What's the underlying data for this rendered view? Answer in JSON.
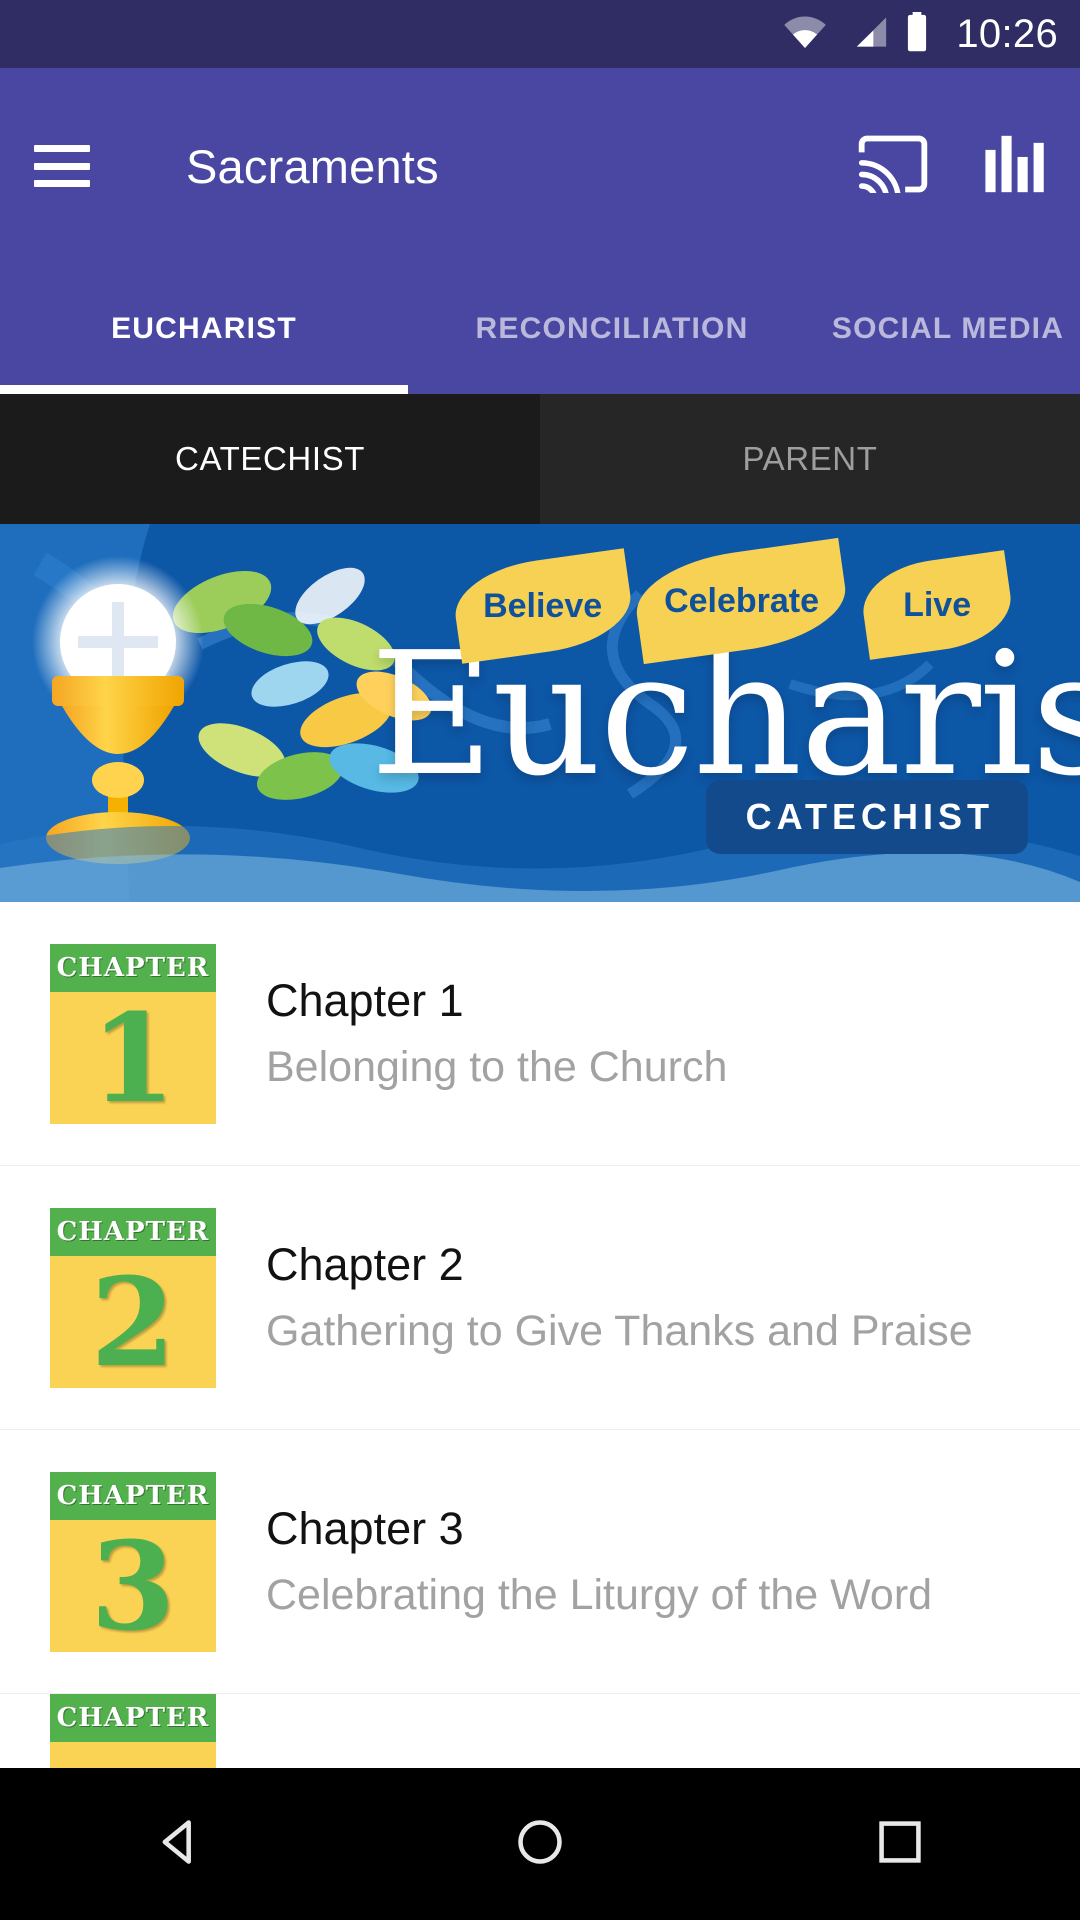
{
  "status_bar": {
    "time": "10:26",
    "icons": [
      "wifi-icon",
      "cellular-signal-icon",
      "battery-icon"
    ],
    "background_color": "#2f2d63"
  },
  "app_bar": {
    "menu_icon": "hamburger-menu-icon",
    "title": "Sacraments",
    "actions": [
      "cast-icon",
      "bar-chart-icon"
    ],
    "background_color": "#4a47a3"
  },
  "primary_tabs": {
    "items": [
      {
        "label": "EUCHARIST",
        "active": true
      },
      {
        "label": "RECONCILIATION",
        "active": false
      },
      {
        "label": "SOCIAL MEDIA",
        "active": false
      }
    ],
    "indicator_color": "#ffffff"
  },
  "sub_tabs": {
    "items": [
      {
        "label": "CATECHIST",
        "active": true
      },
      {
        "label": "PARENT",
        "active": false
      }
    ],
    "active_background": "#1b1b1b",
    "inactive_background": "#262626"
  },
  "banner": {
    "title": "Eucharist",
    "leaves": [
      "Believe",
      "Celebrate",
      "Live"
    ],
    "badge": "CATECHIST",
    "background_color": "#0d57a7",
    "leaf_color": "#f6d154",
    "leaf_text_color": "#10519b"
  },
  "chapters": [
    {
      "thumb_label": "CHAPTER",
      "number": "1",
      "title": "Chapter 1",
      "subtitle": "Belonging to the Church"
    },
    {
      "thumb_label": "CHAPTER",
      "number": "2",
      "title": "Chapter 2",
      "subtitle": "Gathering to Give Thanks and Praise"
    },
    {
      "thumb_label": "CHAPTER",
      "number": "3",
      "title": "Chapter 3",
      "subtitle": "Celebrating the Liturgy of the Word"
    }
  ],
  "chapter_partial": {
    "thumb_label": "CHAPTER"
  },
  "nav_bar": {
    "buttons": [
      "back-icon",
      "home-icon",
      "recents-icon"
    ],
    "background_color": "#000000"
  }
}
